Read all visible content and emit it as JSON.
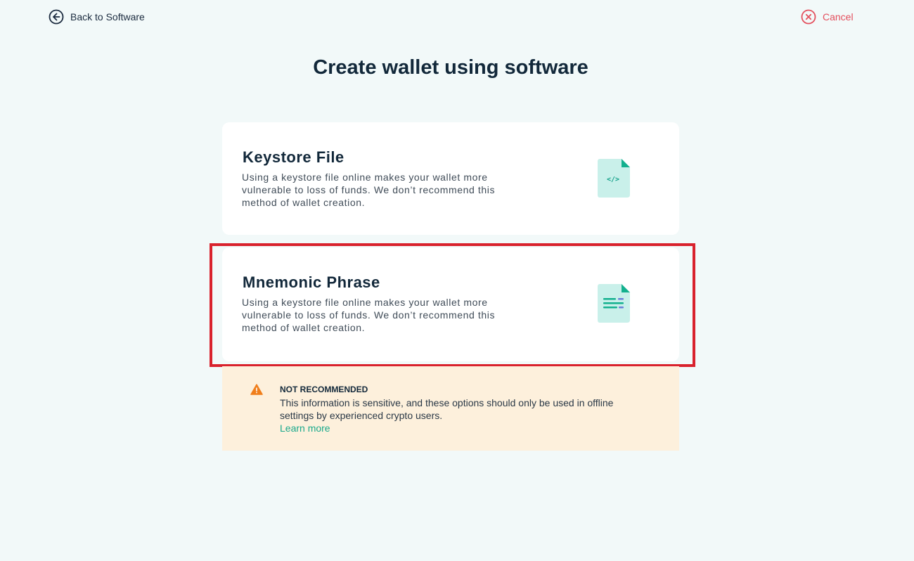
{
  "header": {
    "back_label": "Back to Software",
    "cancel_label": "Cancel"
  },
  "page": {
    "title": "Create wallet using software"
  },
  "options": [
    {
      "title": "Keystore File",
      "description": "Using a keystore file online makes your wallet more vulnerable to loss of funds. We don’t recommend this method of wallet creation.",
      "icon": "keystore-file-icon"
    },
    {
      "title": "Mnemonic Phrase",
      "description": "Using a keystore file online makes your wallet more vulnerable to loss of funds. We don’t recommend this method of wallet creation.",
      "icon": "mnemonic-file-icon"
    }
  ],
  "warning": {
    "title": "NOT RECOMMENDED",
    "text": "This information is sensitive, and these options should only be used in offline settings by experienced crypto users.",
    "link_label": "Learn more",
    "icon": "warning-triangle-icon"
  },
  "colors": {
    "background": "#f2f9f9",
    "accent_green": "#1aa98c",
    "cancel_red": "#e4505e",
    "warning_bg": "#fdf0dc",
    "warning_orange": "#f07e1b",
    "highlight_red": "#d9222d"
  }
}
